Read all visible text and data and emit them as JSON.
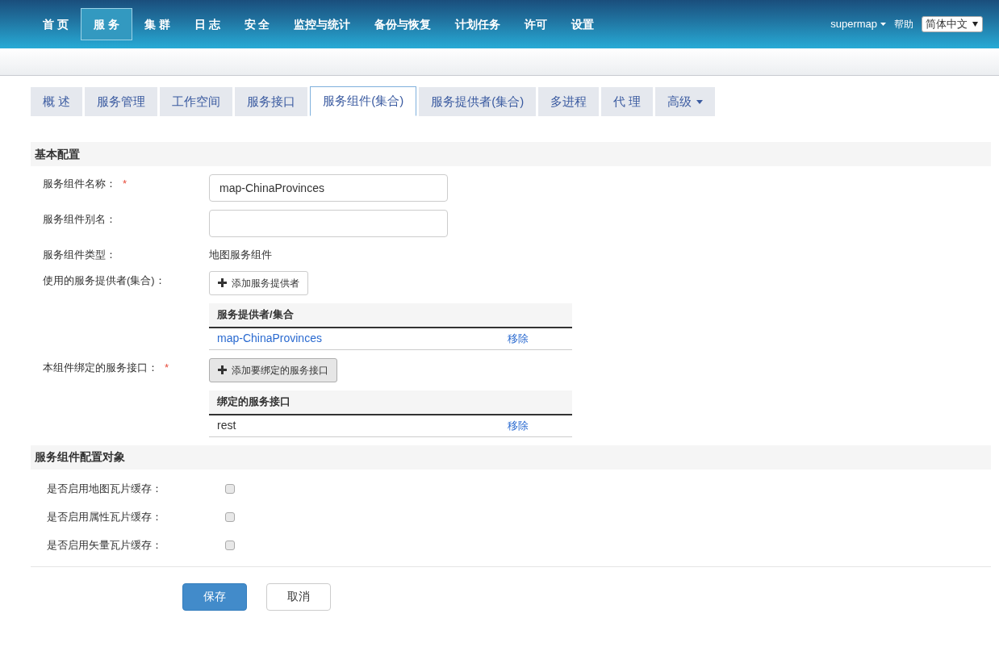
{
  "nav": {
    "items": [
      {
        "label": "首 页",
        "selected": false
      },
      {
        "label": "服 务",
        "selected": true
      },
      {
        "label": "集 群",
        "selected": false
      },
      {
        "label": "日 志",
        "selected": false
      },
      {
        "label": "安 全",
        "selected": false
      },
      {
        "label": "监控与统计",
        "selected": false
      },
      {
        "label": "备份与恢复",
        "selected": false
      },
      {
        "label": "计划任务",
        "selected": false
      },
      {
        "label": "许可",
        "selected": false
      },
      {
        "label": "设置",
        "selected": false
      }
    ],
    "user": "supermap",
    "help": "帮助",
    "language": "简体中文"
  },
  "tabs": [
    {
      "label": "概 述",
      "selected": false,
      "kind": "tab"
    },
    {
      "label": "服务管理",
      "selected": false,
      "kind": "tab"
    },
    {
      "label": "工作空间",
      "selected": false,
      "kind": "tab"
    },
    {
      "label": "服务接口",
      "selected": false,
      "kind": "tab"
    },
    {
      "label": "服务组件(集合)",
      "selected": true,
      "kind": "tab"
    },
    {
      "label": "服务提供者(集合)",
      "selected": false,
      "kind": "tab"
    },
    {
      "label": "多进程",
      "selected": false,
      "kind": "tab"
    },
    {
      "label": "代 理",
      "selected": false,
      "kind": "tab"
    },
    {
      "label": "高级",
      "selected": false,
      "kind": "dropdown"
    }
  ],
  "basic_config": {
    "title": "基本配置",
    "fields": [
      {
        "kind": "input",
        "label": "服务组件名称：",
        "required_mark": "*",
        "value": "map-ChinaProvinces"
      },
      {
        "kind": "input",
        "label": "服务组件别名："
      },
      {
        "kind": "text",
        "label": "服务组件类型：",
        "value": "地图服务组件"
      },
      {
        "kind": "list",
        "label": "使用的服务提供者(集合)：",
        "button": "添加服务提供者",
        "button_pressed": false,
        "column": "服务提供者/集合",
        "rows": [
          {
            "name": "map-ChinaProvinces",
            "link": true,
            "action": "移除"
          }
        ]
      },
      {
        "kind": "list",
        "label": "本组件绑定的服务接口：",
        "required_mark": "*",
        "button": "添加要绑定的服务接口",
        "button_pressed": true,
        "column": "绑定的服务接口",
        "rows": [
          {
            "name": "rest",
            "link": false,
            "action": "移除"
          }
        ]
      }
    ]
  },
  "config_objects": {
    "title": "服务组件配置对象",
    "options": [
      {
        "label": "是否启用地图瓦片缓存：",
        "checked": false
      },
      {
        "label": "是否启用属性瓦片缓存：",
        "checked": false
      },
      {
        "label": "是否启用矢量瓦片缓存：",
        "checked": false
      }
    ]
  },
  "actions": [
    {
      "label": "保存",
      "kind": "primary"
    },
    {
      "label": "取消",
      "kind": "default"
    }
  ]
}
